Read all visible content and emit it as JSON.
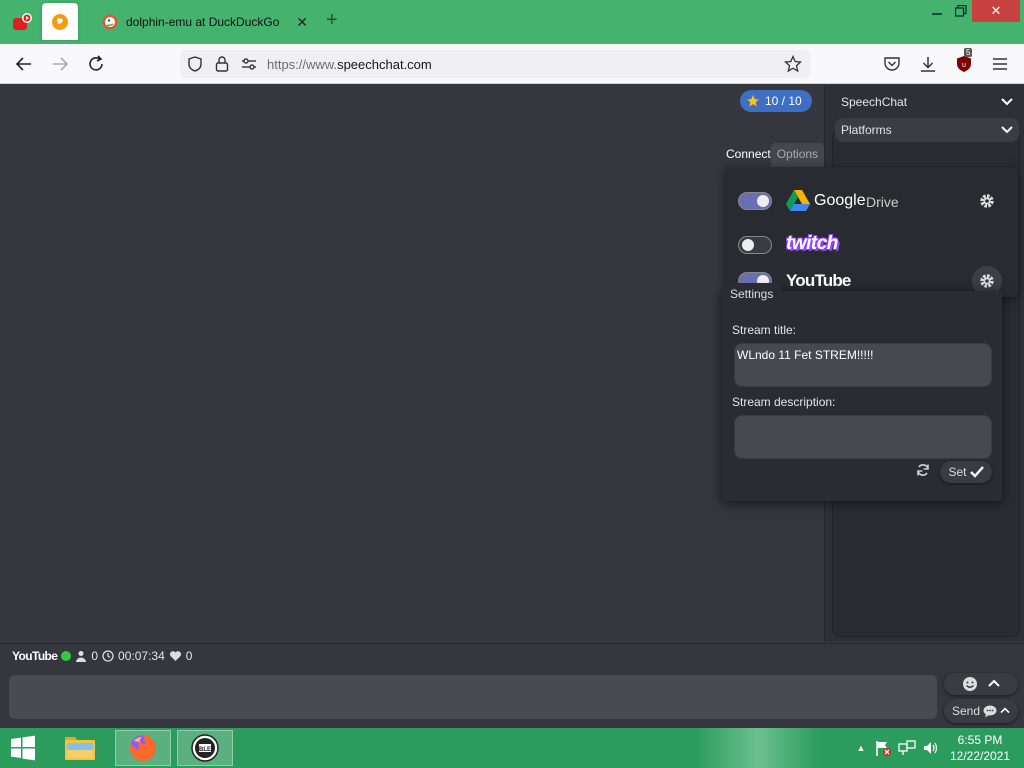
{
  "browser": {
    "tab_title": "dolphin-emu at DuckDuckGo",
    "url_prefix": "https://www.",
    "url_domain": "speechchat.com",
    "extension_badge": "5"
  },
  "header": {
    "stars": "10 / 10"
  },
  "sidebar": {
    "speechchat_label": "SpeechChat",
    "platforms_label": "Platforms"
  },
  "popup": {
    "tab_connect": "Connect",
    "tab_options": "Options",
    "platforms": [
      {
        "name": "Google Drive",
        "enabled": true
      },
      {
        "name": "twitch",
        "enabled": false
      },
      {
        "name": "YouTube",
        "enabled": true
      }
    ],
    "google_word": "Google",
    "drive_word": "Drive",
    "settings_tab": "Settings",
    "stream_title_label": "Stream title:",
    "stream_title_value": "WLndo 11 Fet STREM!!!!!",
    "stream_description_label": "Stream description:",
    "stream_description_value": "",
    "set_label": "Set"
  },
  "status": {
    "platform": "YouTube",
    "viewers": "0",
    "uptime": "00:07:34",
    "likes": "0"
  },
  "chat": {
    "send_label": "Send"
  },
  "taskbar": {
    "time": "6:55 PM",
    "date": "12/22/2021"
  },
  "colors": {
    "window_green": "#45b36e",
    "page_bg": "#35363e",
    "toggle_on": "#6870b3",
    "live_green": "#2ecc40",
    "twitch_purple": "#9146ff",
    "close_red": "#c94040"
  }
}
